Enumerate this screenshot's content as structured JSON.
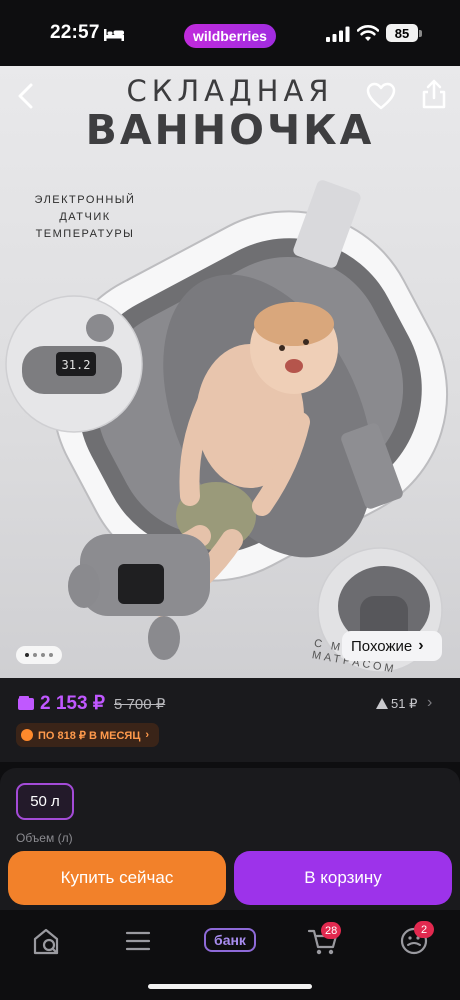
{
  "status_bar": {
    "time": "22:57",
    "app_pill": "wildberries",
    "battery": "85",
    "icons": [
      "bed-icon",
      "signal-icon",
      "wifi-icon",
      "battery-icon"
    ]
  },
  "product_image": {
    "title_line1": "СКЛАДНАЯ",
    "title_line2": "ВАННОЧКА",
    "caption_line1": "ЭЛЕКТРОННЫЙ",
    "caption_line2": "ДАТЧИК ТЕМПЕРАТУРЫ",
    "sensor_readout": "31.2",
    "arc_text": "С МЯГКИМ МАТРАСОМ",
    "carousel_dots": 4,
    "active_dot": 0,
    "similar_label": "Похожие"
  },
  "price": {
    "current": "2 153 ₽",
    "old": "5 700 ₽",
    "rating_count": "51 ₽",
    "installment": "ПО 818 ₽ В МЕСЯЦ"
  },
  "options": {
    "selected_size": "50 л",
    "size_label": "Объем (л)"
  },
  "actions": {
    "buy_now": "Купить сейчас",
    "to_cart": "В корзину"
  },
  "tab_bar": {
    "bank_label": "банк",
    "cart_badge": "28",
    "profile_badge": "2"
  },
  "colors": {
    "accent_purple": "#9d33ea",
    "price_purple": "#c058ff",
    "buy_orange": "#f2812a",
    "badge_red": "#e2294f",
    "background": "#0e0e10",
    "card": "#1a1a1d"
  }
}
